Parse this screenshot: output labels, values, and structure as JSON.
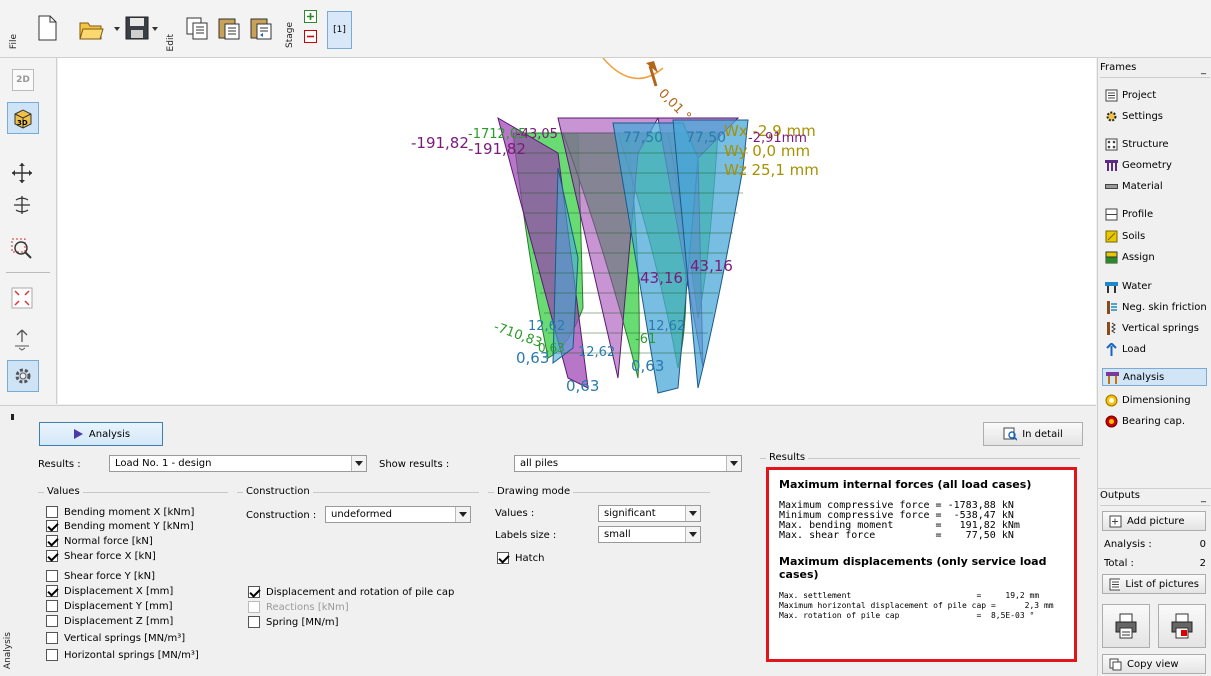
{
  "toolbar": {
    "file": "File",
    "edit": "Edit",
    "stage": "Stage",
    "stage_num": "[1]"
  },
  "left_tools": {
    "view2d": "2D"
  },
  "panel_labels": {
    "analysis": "Analysis"
  },
  "frames": {
    "title": "Frames",
    "items": [
      {
        "label": "Project",
        "icon": "project-icon",
        "color": "#555555"
      },
      {
        "label": "Settings",
        "icon": "settings-icon",
        "color": "#333333"
      },
      {
        "label": "Structure",
        "icon": "structure-icon",
        "color": "#555555"
      },
      {
        "label": "Geometry",
        "icon": "geometry-icon",
        "color": "#5b2a86"
      },
      {
        "label": "Material",
        "icon": "material-icon",
        "color": "#444444"
      },
      {
        "label": "Profile",
        "icon": "profile-icon",
        "color": "#444444"
      },
      {
        "label": "Soils",
        "icon": "soils-icon",
        "color": "#d9b400"
      },
      {
        "label": "Assign",
        "icon": "assign-icon",
        "color": "#2a7a2a"
      },
      {
        "label": "Water",
        "icon": "water-icon",
        "color": "#1e88c8"
      },
      {
        "label": "Neg. skin friction",
        "icon": "neg-skin-friction-icon",
        "color": "#8a4a1a"
      },
      {
        "label": "Vertical springs",
        "icon": "vertical-springs-icon",
        "color": "#8a4a1a"
      },
      {
        "label": "Load",
        "icon": "load-icon",
        "color": "#1565c0"
      },
      {
        "label": "Analysis",
        "icon": "analysis-icon",
        "color": "#c77700"
      },
      {
        "label": "Dimensioning",
        "icon": "dimensioning-icon",
        "color": "#e0a000"
      },
      {
        "label": "Bearing cap.",
        "icon": "bearing-cap-icon",
        "color": "#c00000"
      }
    ]
  },
  "outputs": {
    "title": "Outputs",
    "add_picture": "Add picture",
    "analysis_label": "Analysis :",
    "analysis_count": "0",
    "total_label": "Total :",
    "total_count": "2",
    "list_pictures": "List of pictures",
    "copy_view": "Copy view"
  },
  "viewport_labels": {
    "top_moment": "-191,82",
    "top_moment2": "-191,82",
    "top_mixed": "-1712,05",
    "top_mixed2": "-43,05",
    "top_blue1": "77,50",
    "top_blue2": "77,50",
    "wx": "Wx -2,9 mm",
    "wx2": "-2,91mm",
    "wy": "Wy 0,0 mm",
    "wz": "Wz 25,1 mm",
    "rot": "0,01 °",
    "mid1": "43,16",
    "mid2": "43,16",
    "low1": "-710,83",
    "low2": "12,62",
    "low3": "12,62",
    "low4": "12,62",
    "low5": "-61",
    "bot1": "0,63",
    "bot2": "0,63",
    "bot3": "0,63",
    "bot4": "0,63"
  },
  "analysis_panel": {
    "analysis_button": "Analysis",
    "in_detail_button": "In detail",
    "results_label": "Results :",
    "results_value": "Load No. 1 - design",
    "show_results_label": "Show results :",
    "show_results_value": "all piles",
    "values_group": "Values",
    "values": [
      {
        "label": "Bending moment X [kNm]",
        "checked": false
      },
      {
        "label": "Bending moment Y [kNm]",
        "checked": true
      },
      {
        "label": "Normal force [kN]",
        "checked": true
      },
      {
        "label": "Shear force X [kN]",
        "checked": true
      },
      {
        "label": "Shear force Y [kN]",
        "checked": false
      },
      {
        "label": "Displacement X [mm]",
        "checked": true
      },
      {
        "label": "Displacement  Y [mm]",
        "checked": false
      },
      {
        "label": "Displacement  Z [mm]",
        "checked": false
      },
      {
        "label": "Vertical springs [MN/m³]",
        "checked": false
      },
      {
        "label": "Horizontal springs [MN/m³]",
        "checked": false
      }
    ],
    "construction_group": "Construction",
    "construction_label": "Construction :",
    "construction_value": "undeformed",
    "displacement_rotation": "Displacement and rotation of pile cap",
    "reactions": "Reactions [kNm]",
    "spring": "Spring [MN/m]",
    "drawing_group": "Drawing mode",
    "values_label": "Values :",
    "values_value": "significant",
    "labels_size_label": "Labels size :",
    "labels_size_value": "small",
    "hatch": "Hatch"
  },
  "results": {
    "group_title": "Results",
    "heading1": "Maximum internal forces (all load cases)",
    "forces": [
      {
        "name": "Maximum compressive force",
        "eq": "=",
        "value": "-1783,88",
        "unit": "kN"
      },
      {
        "name": "Minimum compressive force",
        "eq": "=",
        "value": " -538,47",
        "unit": "kN"
      },
      {
        "name": "Max. bending moment      ",
        "eq": "=",
        "value": "  191,82",
        "unit": "kNm"
      },
      {
        "name": "Max. shear force         ",
        "eq": "=",
        "value": "   77,50",
        "unit": "kN"
      }
    ],
    "heading2": "Maximum displacements (only service load cases)",
    "displacements": [
      {
        "name": "Max. settlement                         ",
        "eq": "=",
        "value": "    19,2",
        "unit": "mm"
      },
      {
        "name": "Maximum horizontal displacement of pile cap",
        "eq": "=",
        "value": "     2,3",
        "unit": "mm"
      },
      {
        "name": "Max. rotation of pile cap               ",
        "eq": "=",
        "value": " 8,5E-03",
        "unit": "°"
      }
    ],
    "highlight_color": "#e0161b"
  }
}
